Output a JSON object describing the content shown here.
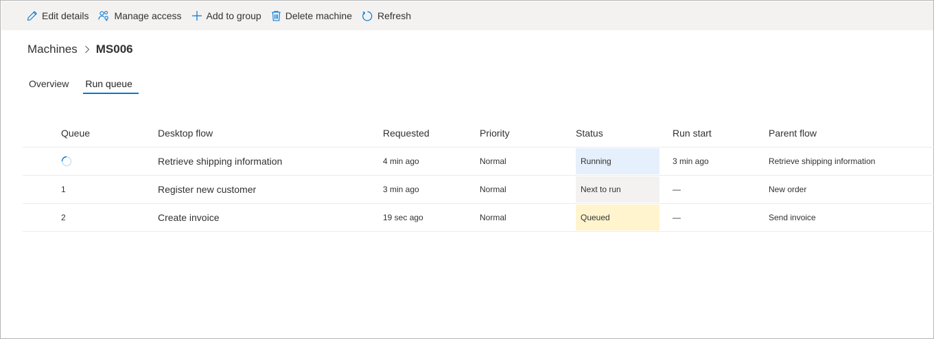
{
  "toolbar": {
    "edit_label": "Edit details",
    "manage_label": "Manage access",
    "add_label": "Add to group",
    "delete_label": "Delete machine",
    "refresh_label": "Refresh"
  },
  "breadcrumb": {
    "parent": "Machines",
    "current": "MS006"
  },
  "tabs": [
    {
      "label": "Overview",
      "active": false
    },
    {
      "label": "Run queue",
      "active": true
    }
  ],
  "table": {
    "headers": {
      "queue": "Queue",
      "flow": "Desktop flow",
      "requested": "Requested",
      "priority": "Priority",
      "status": "Status",
      "run_start": "Run start",
      "parent_flow": "Parent flow"
    },
    "rows": [
      {
        "queue": "",
        "flow": "Retrieve shipping information",
        "requested": "4 min ago",
        "priority": "Normal",
        "status": "Running",
        "run_start": "3 min ago",
        "parent_flow": "Retrieve shipping information"
      },
      {
        "queue": "1",
        "flow": "Register new customer",
        "requested": "3 min ago",
        "priority": "Normal",
        "status": "Next to run",
        "run_start": "—",
        "parent_flow": "New order"
      },
      {
        "queue": "2",
        "flow": "Create invoice",
        "requested": "19 sec ago",
        "priority": "Normal",
        "status": "Queued",
        "run_start": "—",
        "parent_flow": "Send invoice"
      }
    ]
  },
  "colors": {
    "accent": "#0078d4",
    "status_running": "#e6f0fc",
    "status_next": "#f3f2f1",
    "status_queued": "#fff4ce"
  }
}
